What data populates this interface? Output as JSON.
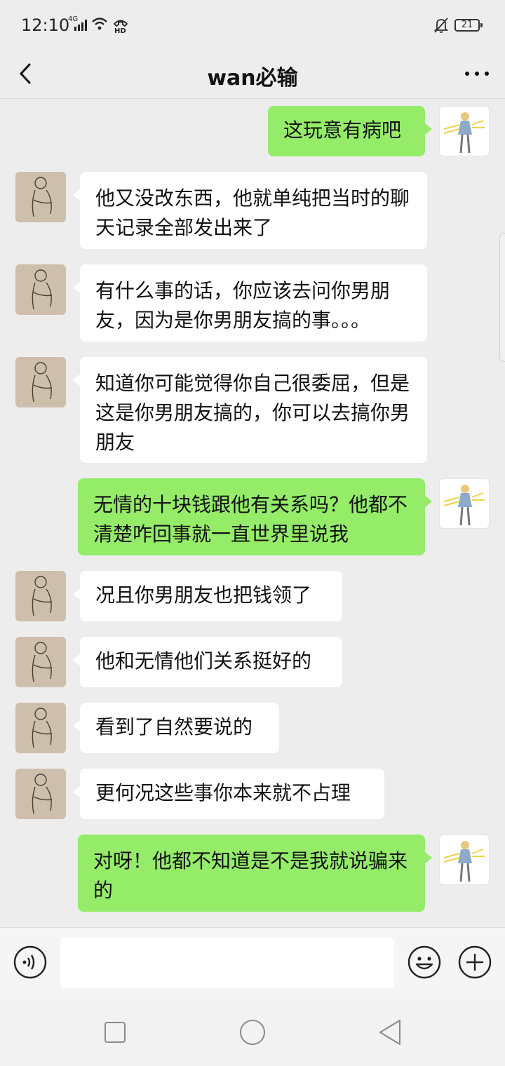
{
  "status_bar": {
    "time": "12:10",
    "network": "4G",
    "battery": "21"
  },
  "header": {
    "title": "wan必输"
  },
  "messages": [
    {
      "side": "out",
      "text": "这玩意有病吧"
    },
    {
      "side": "in",
      "text": "他又没改东西，他就单纯把当时的聊天记录全部发出来了"
    },
    {
      "side": "in",
      "text": "有什么事的话，你应该去问你男朋友，因为是你男朋友搞的事。。。"
    },
    {
      "side": "in",
      "text": "知道你可能觉得你自己很委屈，但是这是你男朋友搞的，你可以去搞你男朋友"
    },
    {
      "side": "out",
      "text": "无情的十块钱跟他有关系吗？他都不清楚咋回事就一直世界里说我"
    },
    {
      "side": "in",
      "text": "况且你男朋友也把钱领了"
    },
    {
      "side": "in",
      "text": "他和无情他们关系挺好的"
    },
    {
      "side": "in",
      "text": "看到了自然要说的"
    },
    {
      "side": "in",
      "text": "更何况这些事你本来就不占理"
    },
    {
      "side": "out",
      "text": "对呀！他都不知道是不是我就说骗来的"
    }
  ],
  "icons": {
    "back": "back-arrow-icon",
    "more": "more-dots-icon",
    "voice": "voice-icon",
    "emoji": "emoji-icon",
    "plus": "plus-icon"
  },
  "colors": {
    "outgoing_bubble": "#95ec69",
    "incoming_bubble": "#ffffff",
    "background": "#ededed"
  }
}
